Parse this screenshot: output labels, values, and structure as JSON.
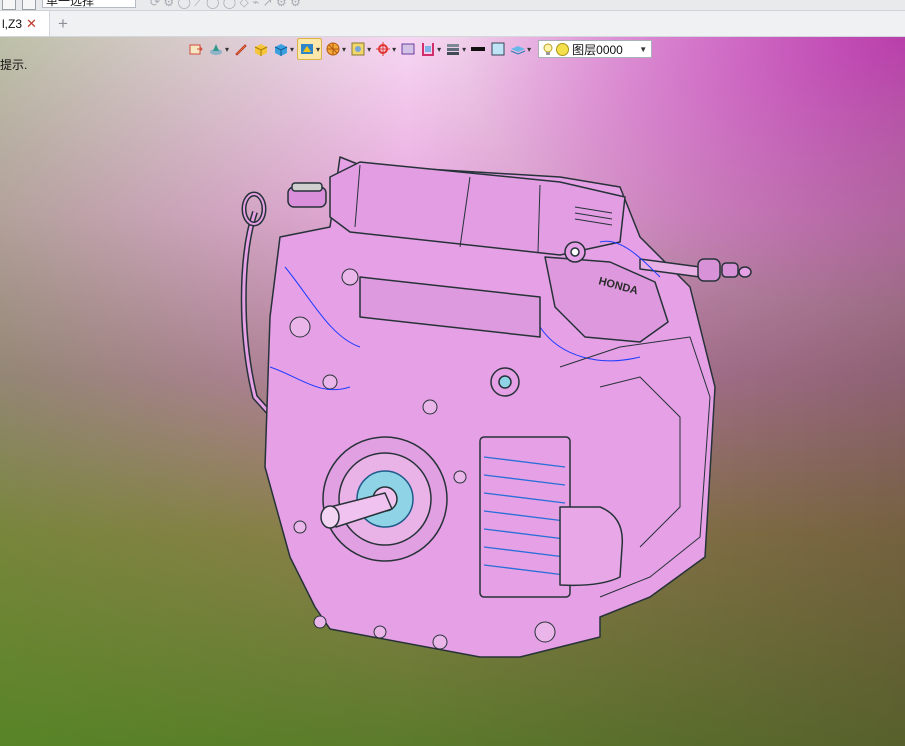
{
  "topbar": {
    "select_label": "单一选择"
  },
  "tabs": [
    {
      "label": "l,Z3",
      "close_glyph": "✕"
    }
  ],
  "tab_add_glyph": "+",
  "viewport": {
    "hint_text": "提示.",
    "layer_label": "图层0000",
    "toolbar_icons": [
      "view-orient-icon",
      "render-mode-icon",
      "pen-icon",
      "shaded-box-icon",
      "solid-cube-icon",
      "display-mode-icon",
      "section-view-icon",
      "fit-view-icon",
      "coordinate-icon",
      "frame-view-icon",
      "clip-plane-icon",
      "layer-stack-icon",
      "line-color-icon",
      "fill-color-icon",
      "layer-manager-icon"
    ],
    "colors": {
      "background_top_right": "#ff3cff",
      "background_bottom_left": "#4f9a1e",
      "model_fill": "#e6a0e6",
      "model_edge": "#263238"
    },
    "brand_on_cover": "HONDA"
  }
}
